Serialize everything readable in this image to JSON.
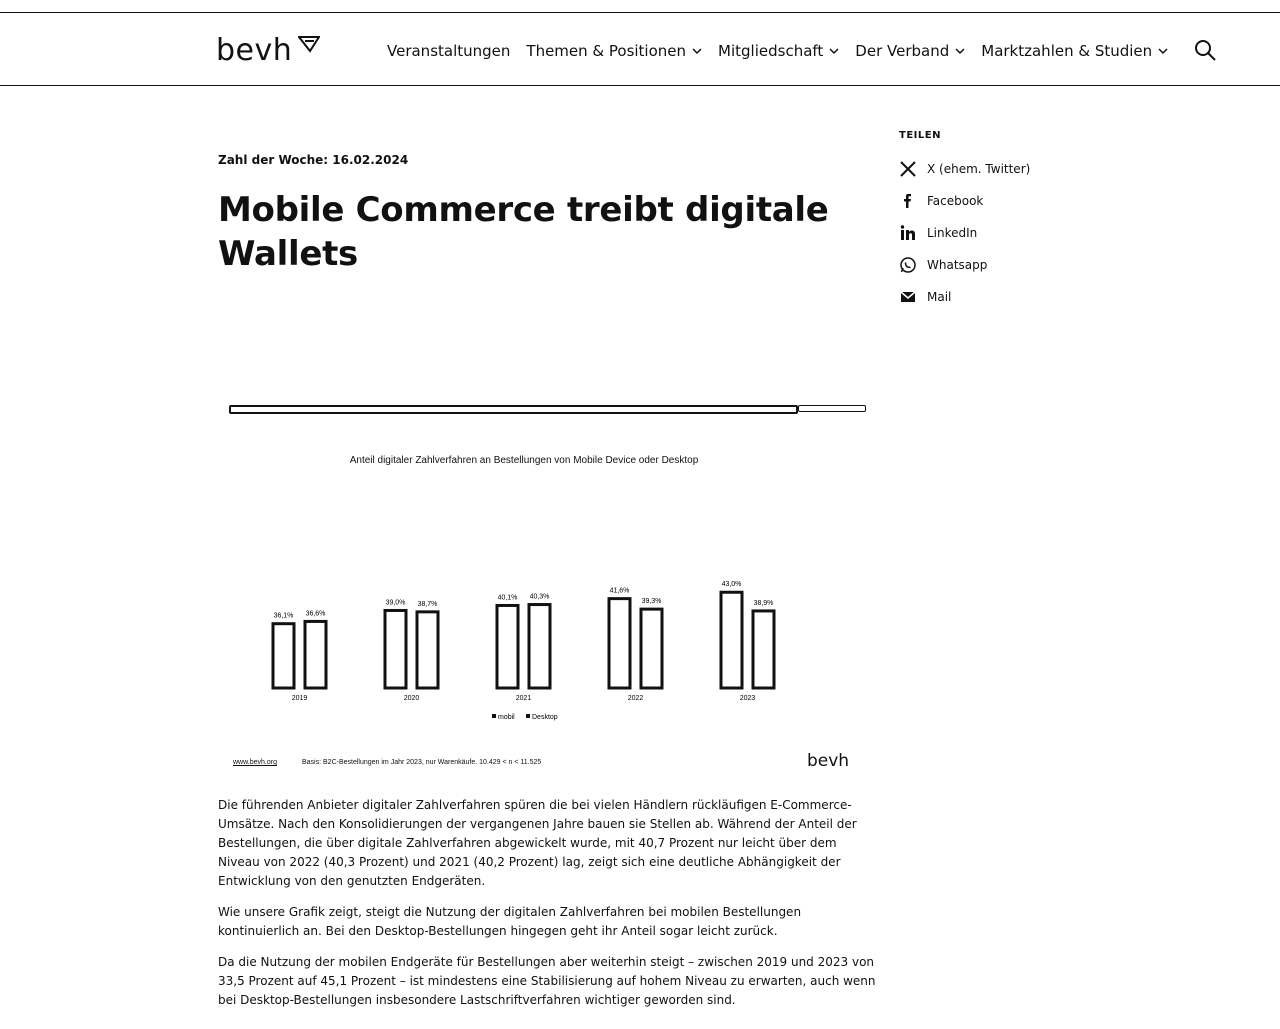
{
  "header": {
    "logo": "bevh",
    "nav": [
      {
        "label": "Veranstaltungen",
        "dropdown": false
      },
      {
        "label": "Themen & Positionen",
        "dropdown": true
      },
      {
        "label": "Mitgliedschaft",
        "dropdown": true
      },
      {
        "label": "Der Verband",
        "dropdown": true
      },
      {
        "label": "Marktzahlen & Studien",
        "dropdown": true
      }
    ]
  },
  "article": {
    "kicker": "Zahl der Woche: 16.02.2024",
    "title": "Mobile Commerce treibt digitale Wallets",
    "paragraphs": [
      "Die führenden Anbieter digitaler Zahlverfahren spüren die bei vielen Händlern rückläufigen E-Commerce-Umsätze. Nach den Konsolidierungen der vergangenen Jahre bauen sie Stellen ab. Während der Anteil der Bestellungen, die über digitale Zahlverfahren abgewickelt wurde, mit 40,7 Prozent nur leicht über dem Niveau von 2022 (40,3 Prozent) und 2021 (40,2 Prozent) lag, zeigt sich eine deutliche Abhängigkeit der Entwicklung von den genutzten Endgeräten.",
      "Wie unsere Grafik zeigt, steigt die Nutzung der digitalen Zahlverfahren bei mobilen Bestellungen kontinuierlich an. Bei den Desktop-Bestellungen hingegen geht ihr Anteil sogar leicht zurück.",
      "Da die Nutzung der mobilen Endgeräte für Bestellungen aber weiterhin steigt – zwischen 2019 und 2023 von 33,5 Prozent auf 45,1 Prozent – ist mindestens eine Stabilisierung auf hohem Niveau zu erwarten, auch wenn bei Desktop-Bestellungen insbesondere Lastschriftverfahren wichtiger geworden sind."
    ]
  },
  "share": {
    "title": "TEILEN",
    "items": [
      {
        "label": "X (ehem. Twitter)",
        "icon": "x-icon"
      },
      {
        "label": "Facebook",
        "icon": "facebook-icon"
      },
      {
        "label": "LinkedIn",
        "icon": "linkedin-icon"
      },
      {
        "label": "Whatsapp",
        "icon": "whatsapp-icon"
      },
      {
        "label": "Mail",
        "icon": "mail-icon"
      }
    ]
  },
  "figure": {
    "footer_link": "www.bevh.org",
    "footer_note": "Basis: B2C-Bestellungen im Jahr 2023, nur Warenkäufe. 10.429 < n < 11.525",
    "logo": "bevh"
  },
  "chart_data": {
    "type": "bar",
    "title": "Anteil digitaler Zahlverfahren an Bestellungen von Mobile Device oder Desktop",
    "categories": [
      "2019",
      "2020",
      "2021",
      "2022",
      "2023"
    ],
    "series": [
      {
        "name": "mobil",
        "values": [
          36.1,
          39.0,
          40.1,
          41.6,
          43.0
        ],
        "labels": [
          "36,1%",
          "39,0%",
          "40,1%",
          "41,6%",
          "43,0%"
        ]
      },
      {
        "name": "Desktop",
        "values": [
          36.6,
          38.7,
          40.3,
          39.3,
          38.9
        ],
        "labels": [
          "36,6%",
          "38,7%",
          "40,3%",
          "39,3%",
          "38,9%"
        ]
      }
    ],
    "legend_position": "bottom",
    "grid": false
  }
}
